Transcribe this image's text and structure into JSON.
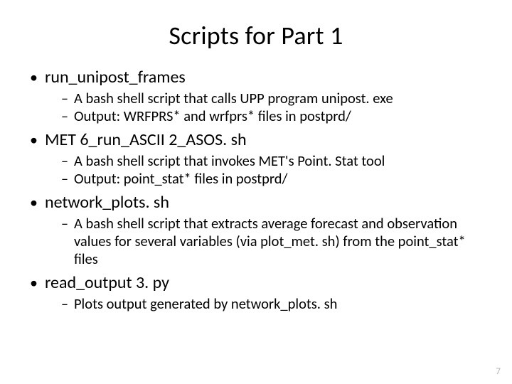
{
  "title": "Scripts for Part 1",
  "items": [
    {
      "label": "run_unipost_frames",
      "sub": [
        "A bash shell script that calls UPP program unipost. exe",
        "Output: WRFPRS* and wrfprs* files in postprd/"
      ]
    },
    {
      "label": "MET 6_run_ASCII 2_ASOS. sh",
      "sub": [
        "A bash shell script that invokes MET's Point. Stat tool",
        "Output: point_stat* files in postprd/"
      ]
    },
    {
      "label": "network_plots. sh",
      "sub": [
        "A bash shell script that extracts average forecast and observation values for several variables (via plot_met. sh) from the point_stat* files"
      ]
    },
    {
      "label": "read_output 3. py",
      "sub": [
        "Plots output generated by network_plots. sh"
      ]
    }
  ],
  "page": "7"
}
